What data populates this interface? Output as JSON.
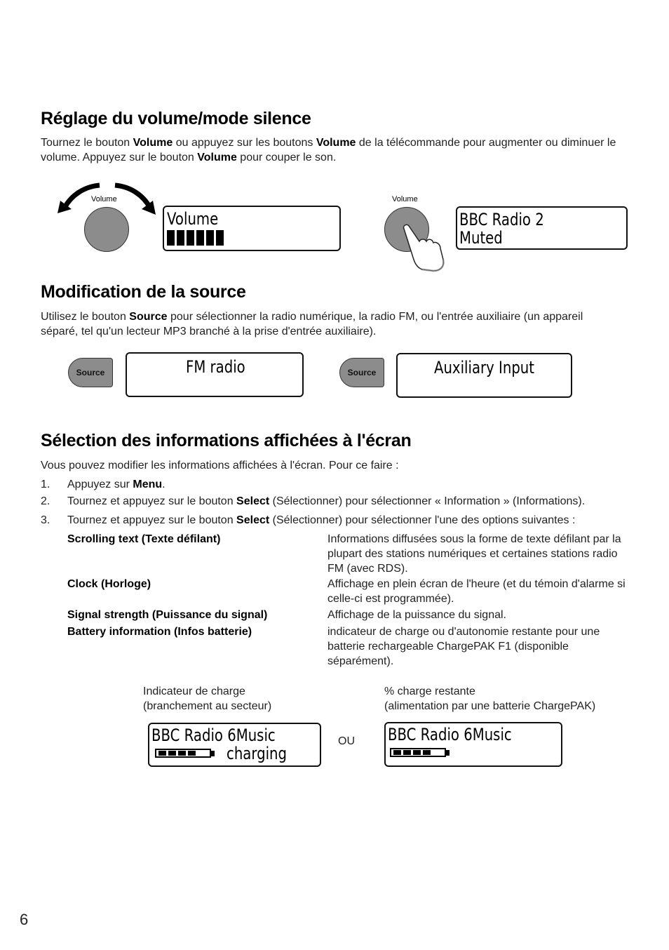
{
  "section_volume": {
    "heading": "Réglage du volume/mode silence",
    "para": [
      {
        "t": "Tournez le bouton ",
        "b": false
      },
      {
        "t": "Volume",
        "b": true
      },
      {
        "t": " ou appuyez sur les boutons ",
        "b": false
      },
      {
        "t": "Volume",
        "b": true
      },
      {
        "t": " de la télécommande pour augmenter ou diminuer le volume. Appuyez sur le bouton ",
        "b": false
      },
      {
        "t": "Volume",
        "b": true
      },
      {
        "t": " pour couper le son.",
        "b": false
      }
    ],
    "knob_label_left": "Volume",
    "knob_label_right": "Volume",
    "lcd_volume": {
      "line1": "Volume",
      "level_bars": 6
    },
    "lcd_muted": {
      "line1": "BBC Radio 2",
      "line2": "Muted"
    }
  },
  "section_source": {
    "heading": "Modification de la source",
    "para": [
      {
        "t": "Utilisez le bouton ",
        "b": false
      },
      {
        "t": "Source",
        "b": true
      },
      {
        "t": " pour sélectionner la radio numérique, la radio FM, ou l'entrée auxiliaire (un appareil séparé, tel qu'un lecteur MP3 branché à la prise d'entrée auxiliaire).",
        "b": false
      }
    ],
    "button_label_1": "Source",
    "button_label_2": "Source",
    "lcd_fm": "FM radio",
    "lcd_aux": "Auxiliary Input"
  },
  "section_info": {
    "heading": "Sélection des informations affichées à l'écran",
    "intro": "Vous pouvez modifier les informations affichées à l'écran. Pour ce faire :",
    "steps": [
      {
        "num": "1.",
        "parts": [
          {
            "t": "Appuyez sur ",
            "b": false
          },
          {
            "t": "Menu",
            "b": true
          },
          {
            "t": ".",
            "b": false
          }
        ]
      },
      {
        "num": "2.",
        "parts": [
          {
            "t": "Tournez et appuyez sur le bouton ",
            "b": false
          },
          {
            "t": "Select",
            "b": true
          },
          {
            "t": " (Sélectionner) pour sélectionner « Information » (Informations).",
            "b": false
          }
        ]
      },
      {
        "num": "3.",
        "parts": [
          {
            "t": "Tournez et appuyez sur le bouton ",
            "b": false
          },
          {
            "t": "Select",
            "b": true
          },
          {
            "t": " (Sélectionner) pour sélectionner l'une des options suivantes :",
            "b": false
          }
        ]
      }
    ],
    "options": [
      {
        "term": "Scrolling text (Texte défilant)",
        "desc": "Informations diffusées sous la forme de texte défilant par la plupart des stations numériques et certaines stations radio FM (avec RDS)."
      },
      {
        "term": "Clock (Horloge)",
        "desc": "Affichage en plein écran de l'heure (et du témoin d'alarme si celle-ci est programmée)."
      },
      {
        "term": "Signal strength (Puissance du signal)",
        "desc": "Affichage de la puissance du signal."
      },
      {
        "term": "Battery information (Infos batterie)",
        "desc": "indicateur de charge ou d'autonomie restante pour une batterie rechargeable ChargePAK F1 (disponible séparément)."
      }
    ],
    "caption_left_1": "Indicateur de charge",
    "caption_left_2": "(branchement au secteur)",
    "caption_right_1": "% charge restante",
    "caption_right_2": "(alimentation par une batterie ChargePAK)",
    "or_label": "OU",
    "lcd_charging": {
      "line1": "BBC Radio 6Music",
      "line2": "charging",
      "battery_segments": 4
    },
    "lcd_remaining": {
      "line1": "BBC Radio 6Music",
      "battery_segments": 4
    }
  },
  "page_number": "6"
}
